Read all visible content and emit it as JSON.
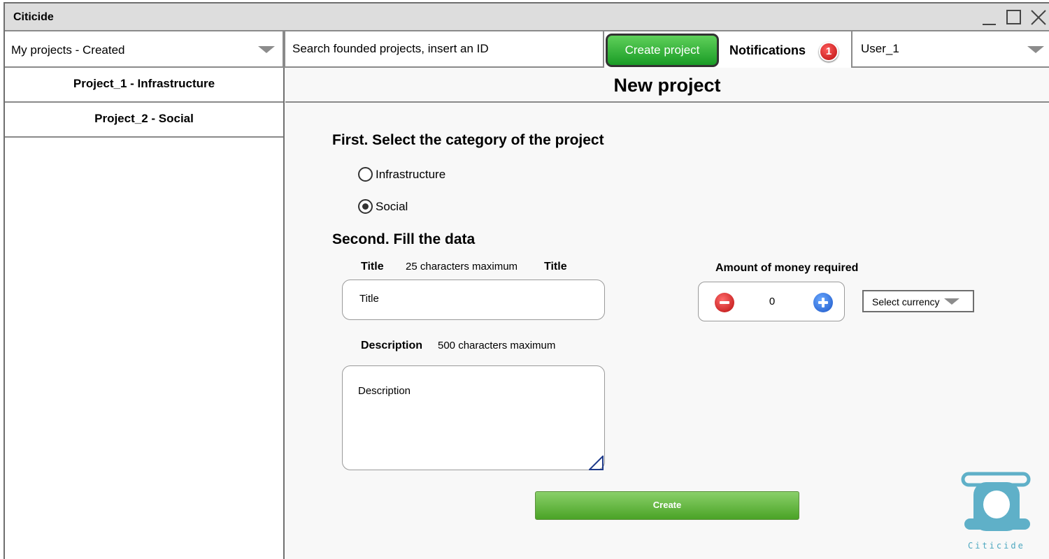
{
  "window": {
    "title": "Citicide"
  },
  "toolbar": {
    "projects_filter": "My projects - Created",
    "search_placeholder": "Search founded projects, insert an ID",
    "create_project_label": "Create project",
    "notifications_label": "Notifications",
    "notifications_count": "1",
    "user_name": "User_1"
  },
  "sidebar": {
    "items": [
      {
        "label": "Project_1 - Infrastructure"
      },
      {
        "label": "Project_2 - Social"
      }
    ]
  },
  "main": {
    "page_title": "New project",
    "step1_heading": "First. Select the category of the project",
    "categories": [
      {
        "label": "Infrastructure",
        "selected": false
      },
      {
        "label": "Social",
        "selected": true
      }
    ],
    "step2_heading": "Second. Fill the data",
    "title_label": "Title",
    "title_hint": "25 characters maximum",
    "title_label_2": "Title",
    "title_placeholder": "Title",
    "description_label": "Description",
    "description_hint": "500 characters maximum",
    "description_placeholder": "Description",
    "amount_label": "Amount of money required",
    "amount_value": "0",
    "currency_placeholder": "Select currency",
    "create_label": "Create"
  },
  "logo": {
    "text": "Citicide",
    "color": "#4ea8c0"
  },
  "colors": {
    "accent_green": "#1a9c26",
    "badge_red": "#b80d0d",
    "plus_blue": "#1b56c7"
  }
}
